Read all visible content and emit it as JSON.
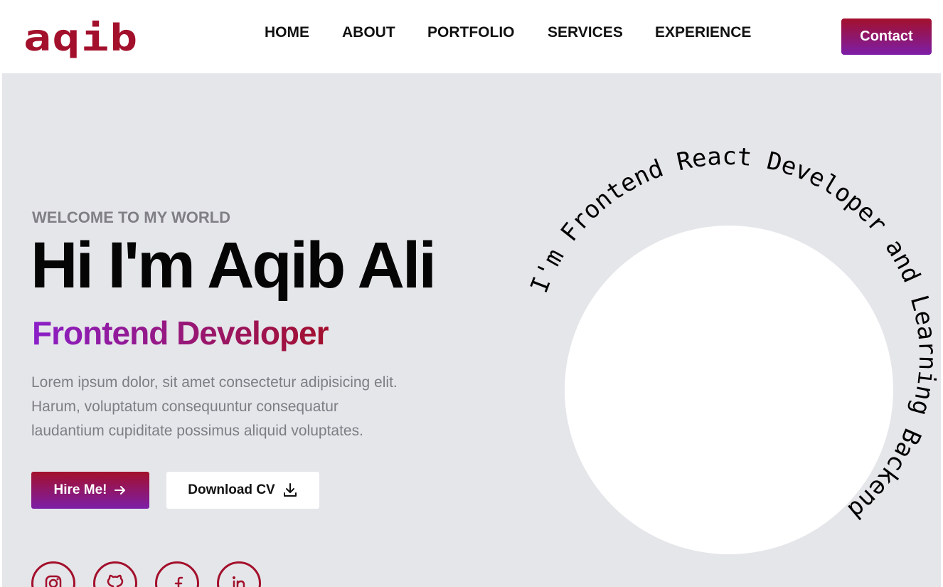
{
  "header": {
    "logo_text": "aqib",
    "nav": [
      "HOME",
      "ABOUT",
      "PORTFOLIO",
      "SERVICES",
      "EXPERIENCE"
    ],
    "contact_label": "Contact"
  },
  "hero": {
    "eyebrow": "WELCOME TO MY WORLD",
    "title": "Hi I'm Aqib Ali",
    "role": "Frontend Developer",
    "bio_lines": [
      "Lorem ipsum dolor, sit amet consectetur adipisicing elit.",
      "Harum, voluptatum consequuntur consequatur",
      "laudantium cupiditate possimus aliquid voluptates."
    ],
    "hire_label": "Hire Me!",
    "hire_icon": "arrow-right-icon",
    "cv_label": "Download CV",
    "cv_icon": "download-icon",
    "socials": [
      "instagram-icon",
      "github-icon",
      "facebook-icon",
      "linkedin-icon"
    ],
    "orbit_text": "I'm Frontend React Developer and Learning Backend"
  },
  "colors": {
    "brand": "#a3102c",
    "accent_purple": "#7c1ea8",
    "hero_background": "#e5e6ea",
    "muted_text": "#7d7d84"
  }
}
